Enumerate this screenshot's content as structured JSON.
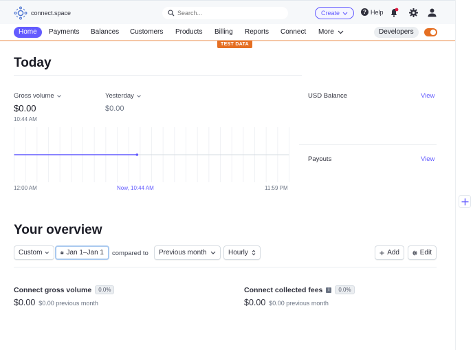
{
  "topbar": {
    "brand": "connect.space",
    "search_placeholder": "Search...",
    "create_label": "Create",
    "help_label": "Help"
  },
  "nav": {
    "items": [
      {
        "label": "Home",
        "active": true
      },
      {
        "label": "Payments"
      },
      {
        "label": "Balances"
      },
      {
        "label": "Customers"
      },
      {
        "label": "Products"
      },
      {
        "label": "Billing"
      },
      {
        "label": "Reports"
      },
      {
        "label": "Connect"
      },
      {
        "label": "More"
      }
    ],
    "developers_label": "Developers",
    "test_mode_on": true,
    "test_data_badge": "TEST DATA"
  },
  "today": {
    "title": "Today",
    "gross_volume": {
      "label": "Gross volume",
      "value": "$0.00",
      "time": "10:44 AM"
    },
    "yesterday": {
      "label": "Yesterday",
      "value": "$0.00"
    },
    "usd_balance": {
      "label": "USD Balance",
      "link": "View"
    },
    "payouts": {
      "label": "Payouts",
      "link": "View"
    }
  },
  "chart_data": {
    "type": "line",
    "title": "Gross volume",
    "x_start_label": "12:00 AM",
    "x_now_label": "Now, 10:44 AM",
    "x_end_label": "11:59 PM",
    "x_range_hours": [
      0,
      24
    ],
    "now_hour": 10.73,
    "gridlines_hourly": true,
    "series": [
      {
        "name": "Today",
        "color": "#635bff",
        "x": [
          0,
          10.73
        ],
        "y": [
          0,
          0
        ]
      },
      {
        "name": "Yesterday",
        "color": "#d5dbe1",
        "x": [
          0,
          24
        ],
        "y": [
          0,
          0
        ]
      }
    ],
    "ylim": [
      -1,
      1
    ]
  },
  "overview": {
    "title": "Your overview",
    "range_select": "Custom",
    "date_range": "Jan 1–Jan 1",
    "compared_to_label": "compared to",
    "compare_select": "Previous month",
    "interval_select": "Hourly",
    "add_label": "Add",
    "edit_label": "Edit",
    "metrics": [
      {
        "title": "Connect gross volume",
        "change": "0.0%",
        "value": "$0.00",
        "previous": "$0.00 previous month",
        "info": false
      },
      {
        "title": "Connect collected fees",
        "change": "0.0%",
        "value": "$0.00",
        "previous": "$0.00 previous month",
        "info": true
      }
    ]
  },
  "colors": {
    "accent": "#635bff",
    "test_mode": "#e56f23"
  }
}
